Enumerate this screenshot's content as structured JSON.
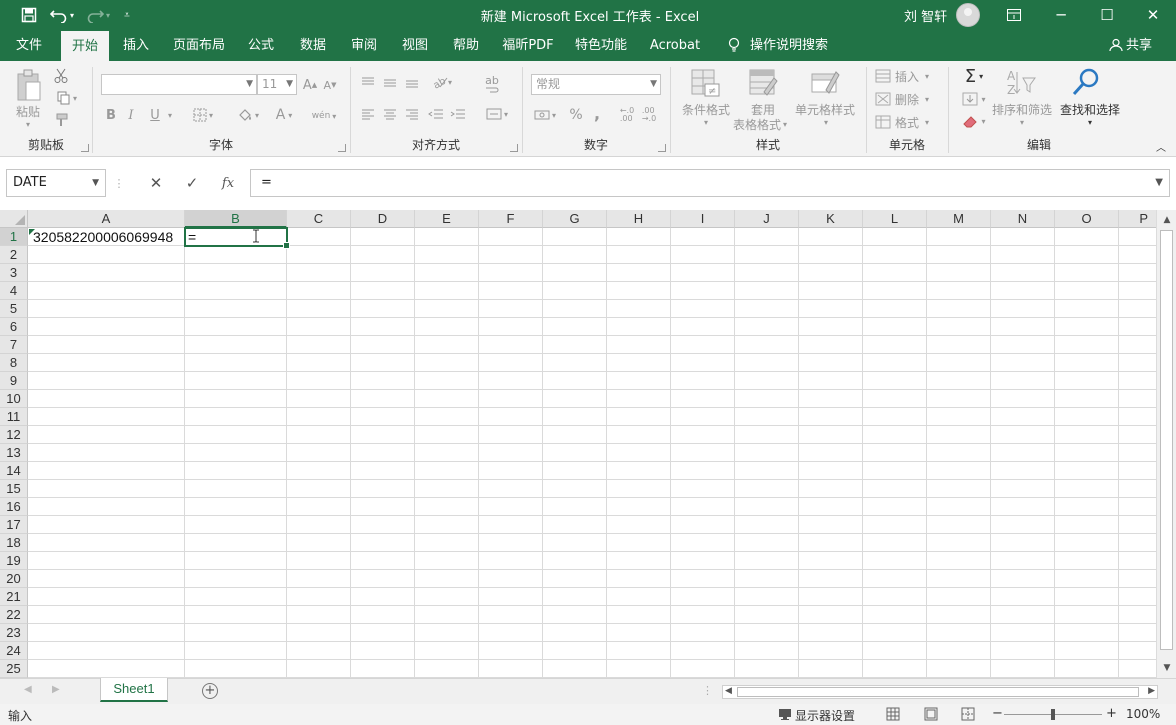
{
  "app": {
    "title": "新建 Microsoft Excel 工作表  -  Excel",
    "user": "刘 智轩"
  },
  "quick_access": {
    "save_icon": "save-icon",
    "undo_icon": "undo-icon",
    "redo_icon": "redo-icon",
    "customize_icon": "customize-qat-icon"
  },
  "window": {
    "ribbon_display": "ribbon-display-icon",
    "minimize": "─",
    "maximize": "☐",
    "close": "✕"
  },
  "tabs": [
    "文件",
    "开始",
    "插入",
    "页面布局",
    "公式",
    "数据",
    "审阅",
    "视图",
    "帮助",
    "福昕PDF",
    "特色功能",
    "Acrobat"
  ],
  "active_tab": "开始",
  "tell_me": "操作说明搜索",
  "share": "共享",
  "ribbon": {
    "clipboard": {
      "label": "剪贴板",
      "paste": "粘贴"
    },
    "font": {
      "label": "字体",
      "font_size": "11",
      "bold": "B",
      "italic": "I",
      "underline": "U",
      "grow": "Aˆ",
      "shrink": "Aˇ",
      "wen": "wén"
    },
    "alignment": {
      "label": "对齐方式",
      "wrap": "ab"
    },
    "number": {
      "label": "数字",
      "format": "常规",
      "percent": "%",
      "comma": ",",
      "inc_dec": "←.0\n.00",
      "dec_dec": ".00\n→.0"
    },
    "styles": {
      "label": "样式",
      "conditional": "条件格式",
      "table_format_1": "套用",
      "table_format_2": "表格格式",
      "cell_styles": "单元格样式"
    },
    "cells": {
      "label": "单元格",
      "insert": "插入",
      "delete": "删除",
      "format": "格式"
    },
    "editing": {
      "label": "编辑",
      "sort_filter": "排序和筛选",
      "find_select": "查找和选择"
    }
  },
  "formula_bar": {
    "name_box": "DATE",
    "cancel": "✕",
    "enter": "✓",
    "fx": "fx",
    "formula": "="
  },
  "columns": [
    "A",
    "B",
    "C",
    "D",
    "E",
    "F",
    "G",
    "H",
    "I",
    "J",
    "K",
    "L",
    "M",
    "N",
    "O",
    "P"
  ],
  "rows": [
    "1",
    "2",
    "3",
    "4",
    "5",
    "6",
    "7",
    "8",
    "9",
    "10",
    "11",
    "12",
    "13",
    "14",
    "15",
    "16",
    "17",
    "18",
    "19",
    "20",
    "21",
    "22",
    "23",
    "24",
    "25"
  ],
  "cells": {
    "A1": "320582200006069948",
    "B1": "="
  },
  "active_cell": "B1",
  "sheets": [
    "Sheet1"
  ],
  "status": {
    "mode": "输入",
    "display_settings": "显示器设置",
    "zoom": "100%",
    "zoom_minus": "−",
    "zoom_plus": "+"
  }
}
